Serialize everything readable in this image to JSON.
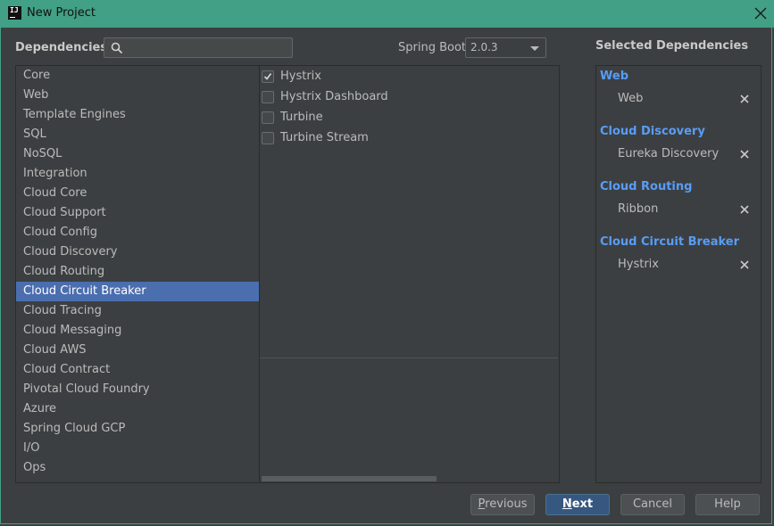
{
  "window": {
    "title": "New Project"
  },
  "header": {
    "dependencies_label": "Dependencies",
    "search_value": "",
    "spring_boot_label": "Spring Boot",
    "spring_boot_version": "2.0.3"
  },
  "categories": [
    {
      "label": "Core"
    },
    {
      "label": "Web"
    },
    {
      "label": "Template Engines"
    },
    {
      "label": "SQL"
    },
    {
      "label": "NoSQL"
    },
    {
      "label": "Integration"
    },
    {
      "label": "Cloud Core"
    },
    {
      "label": "Cloud Support"
    },
    {
      "label": "Cloud Config"
    },
    {
      "label": "Cloud Discovery"
    },
    {
      "label": "Cloud Routing"
    },
    {
      "label": "Cloud Circuit Breaker",
      "selected": true
    },
    {
      "label": "Cloud Tracing"
    },
    {
      "label": "Cloud Messaging"
    },
    {
      "label": "Cloud AWS"
    },
    {
      "label": "Cloud Contract"
    },
    {
      "label": "Pivotal Cloud Foundry"
    },
    {
      "label": "Azure"
    },
    {
      "label": "Spring Cloud GCP"
    },
    {
      "label": "I/O"
    },
    {
      "label": "Ops"
    }
  ],
  "options": [
    {
      "label": "Hystrix",
      "checked": true
    },
    {
      "label": "Hystrix Dashboard",
      "checked": false
    },
    {
      "label": "Turbine",
      "checked": false
    },
    {
      "label": "Turbine Stream",
      "checked": false
    }
  ],
  "selected": {
    "title": "Selected Dependencies",
    "groups": [
      {
        "name": "Web",
        "items": [
          "Web"
        ]
      },
      {
        "name": "Cloud Discovery",
        "items": [
          "Eureka Discovery"
        ]
      },
      {
        "name": "Cloud Routing",
        "items": [
          "Ribbon"
        ]
      },
      {
        "name": "Cloud Circuit Breaker",
        "items": [
          "Hystrix"
        ]
      }
    ]
  },
  "buttons": {
    "previous_first": "P",
    "previous_rest": "revious",
    "next_first": "N",
    "next_rest": "ext",
    "cancel": "Cancel",
    "help": "Help"
  },
  "colors": {
    "titlebar": "#41a085",
    "background": "#3c3f41",
    "selection": "#4b6eaf",
    "group_title": "#589df6",
    "primary_button": "#365880"
  }
}
